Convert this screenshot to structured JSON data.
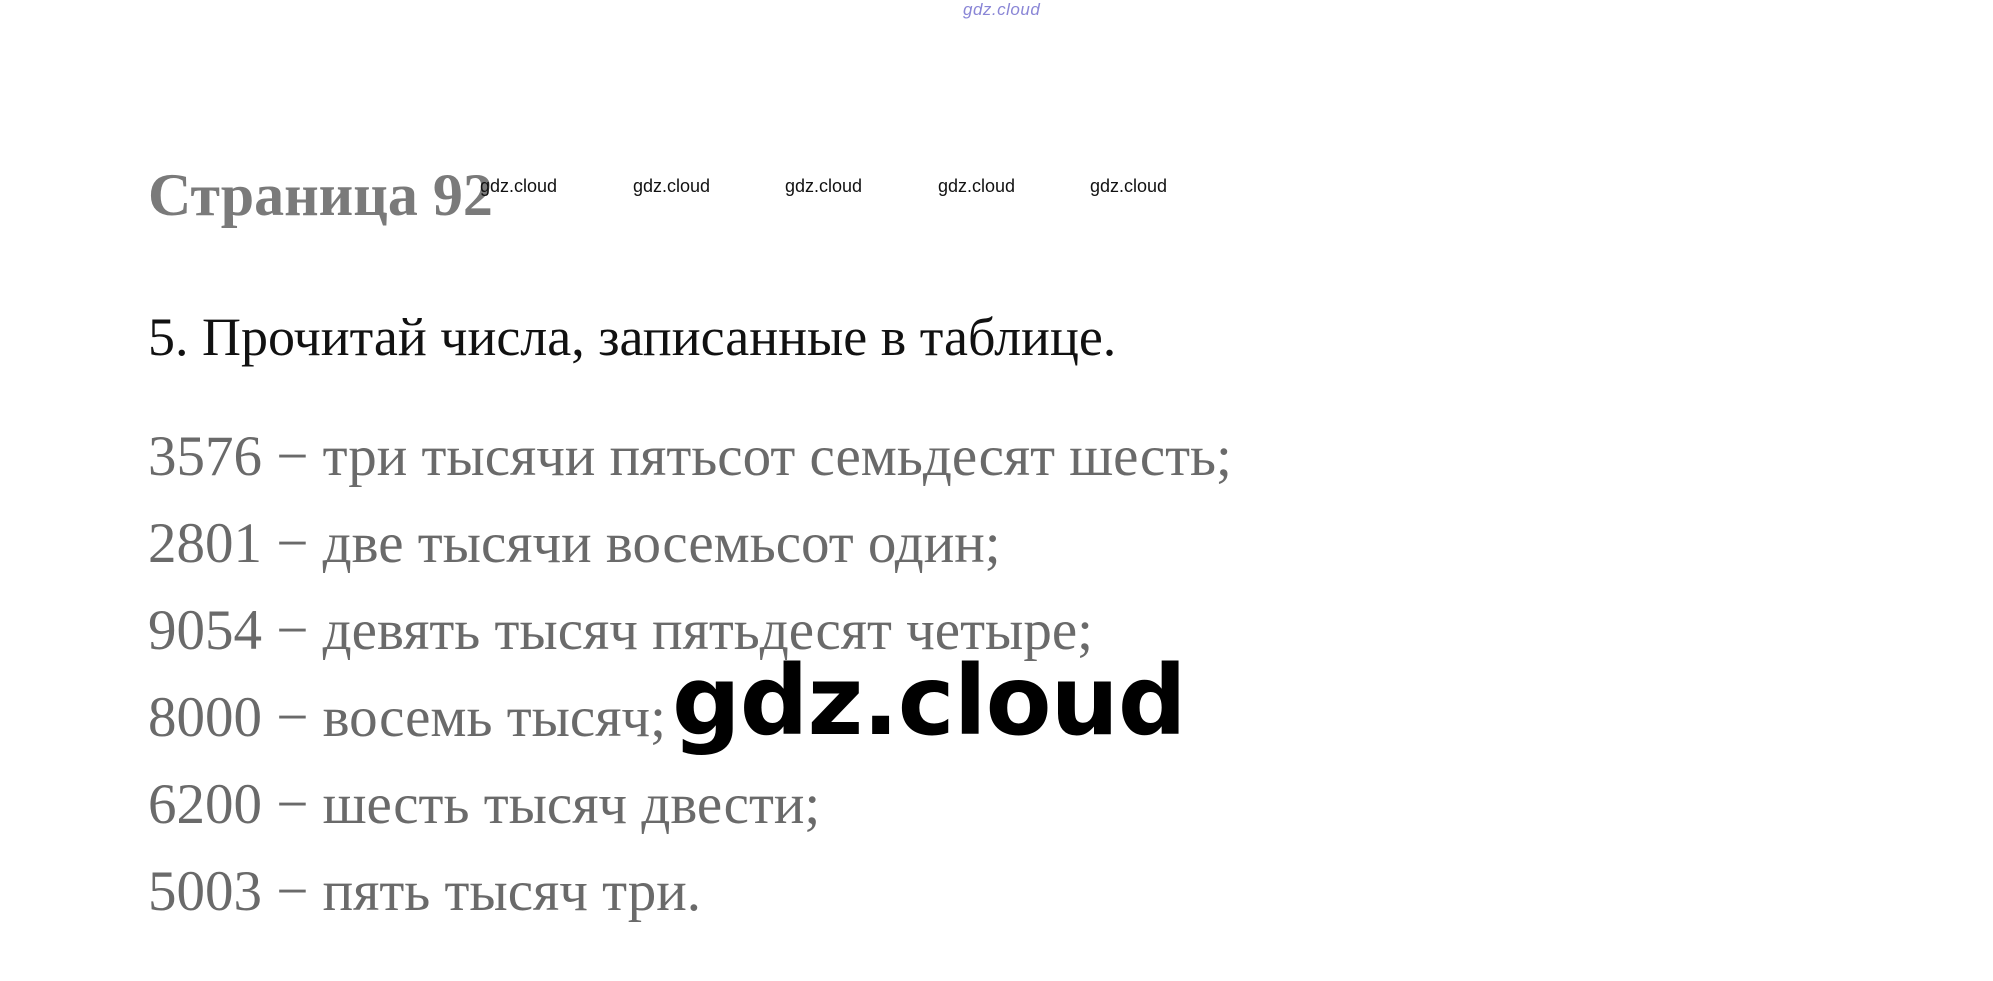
{
  "watermarks": {
    "top": "gdz.cloud",
    "row": [
      "gdz.cloud",
      "gdz.cloud",
      "gdz.cloud",
      "gdz.cloud",
      "gdz.cloud"
    ],
    "center": "gdz.cloud"
  },
  "page": {
    "title": "Страница 92"
  },
  "task": {
    "heading": "5. Прочитай числа, записанные в таблице.",
    "answers": [
      "3576 − три тысячи пятьсот семьдесят шесть;",
      "2801 − две тысячи восемьсот один;",
      "9054 − девять тысяч пятьдесят четыре;",
      "8000 − восемь тысяч;",
      "6200 − шесть тысяч двести;",
      "5003 − пять тысяч три."
    ]
  }
}
